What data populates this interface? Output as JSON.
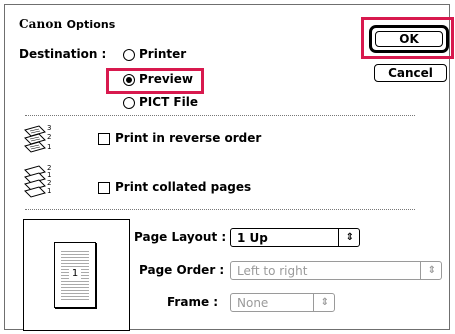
{
  "dialog": {
    "brand": "Canon",
    "title_rest": "Options"
  },
  "buttons": {
    "ok": "OK",
    "cancel": "Cancel"
  },
  "destination": {
    "label": "Destination :",
    "options": [
      "Printer",
      "Preview",
      "PICT File"
    ],
    "selected": "Preview"
  },
  "options": {
    "reverse_label": "Print in reverse order",
    "reverse_checked": false,
    "collated_label": "Print collated pages",
    "collated_checked": false,
    "reverse_icon_numbers": [
      "3",
      "2",
      "1"
    ],
    "collated_icon_numbers": [
      "2",
      "1",
      "2",
      "1"
    ]
  },
  "layout": {
    "page_layout_label": "Page Layout :",
    "page_layout_value": "1 Up",
    "page_order_label": "Page Order :",
    "page_order_value": "Left to right",
    "frame_label": "Frame :",
    "frame_value": "None",
    "preview_page_number": "1"
  },
  "colors": {
    "highlight": "#d8194e"
  }
}
